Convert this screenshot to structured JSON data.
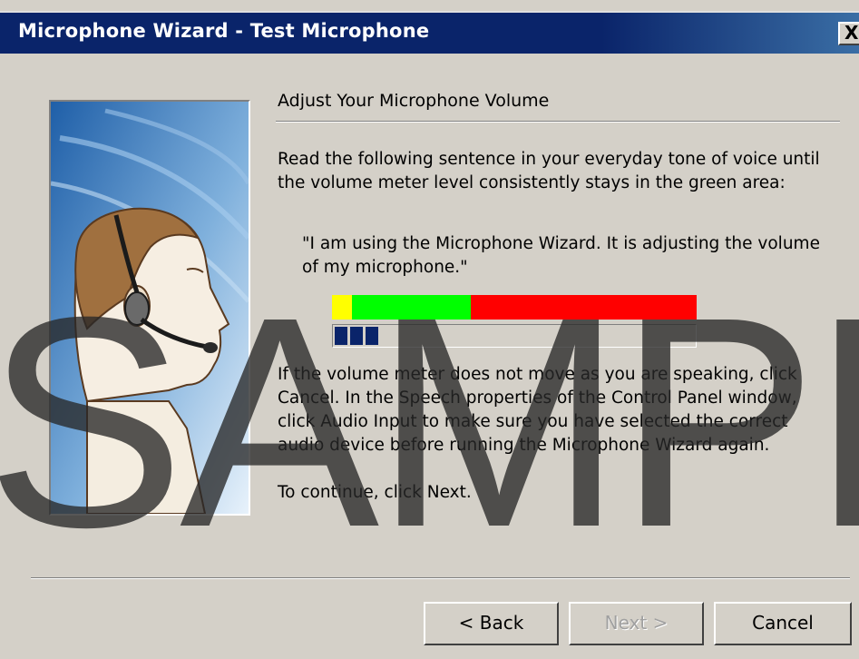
{
  "window": {
    "title": "Microphone Wizard - Test Microphone",
    "close_label": "X"
  },
  "content": {
    "heading": "Adjust Your Microphone Volume",
    "instruction": "Read the following sentence in your everyday tone of voice until the volume meter level consistently stays in the green area:",
    "sentence": "\"I am using the Microphone Wizard. It is adjusting the volume of my microphone.\"",
    "help_text": "If the volume meter does not move as you are speaking, click Cancel. In the Speech properties of the Control Panel window, click Audio Input to make sure you have selected the correct audio device before running the Microphone Wizard again.",
    "continue_text": "To continue, click Next."
  },
  "meter": {
    "level": 0.12,
    "zones": [
      {
        "name": "low",
        "color": "#ffff00",
        "fraction": 0.055
      },
      {
        "name": "good",
        "color": "#00ff00",
        "fraction": 0.325
      },
      {
        "name": "high",
        "color": "#ff0000",
        "fraction": 0.62
      }
    ],
    "fill_color": "#0a246a"
  },
  "buttons": {
    "back": "< Back",
    "next": "Next >",
    "cancel": "Cancel"
  },
  "watermark": {
    "text": "SAMPL"
  },
  "colors": {
    "title_bar": "#0a246a",
    "dialog_bg": "#d4d0c8"
  }
}
